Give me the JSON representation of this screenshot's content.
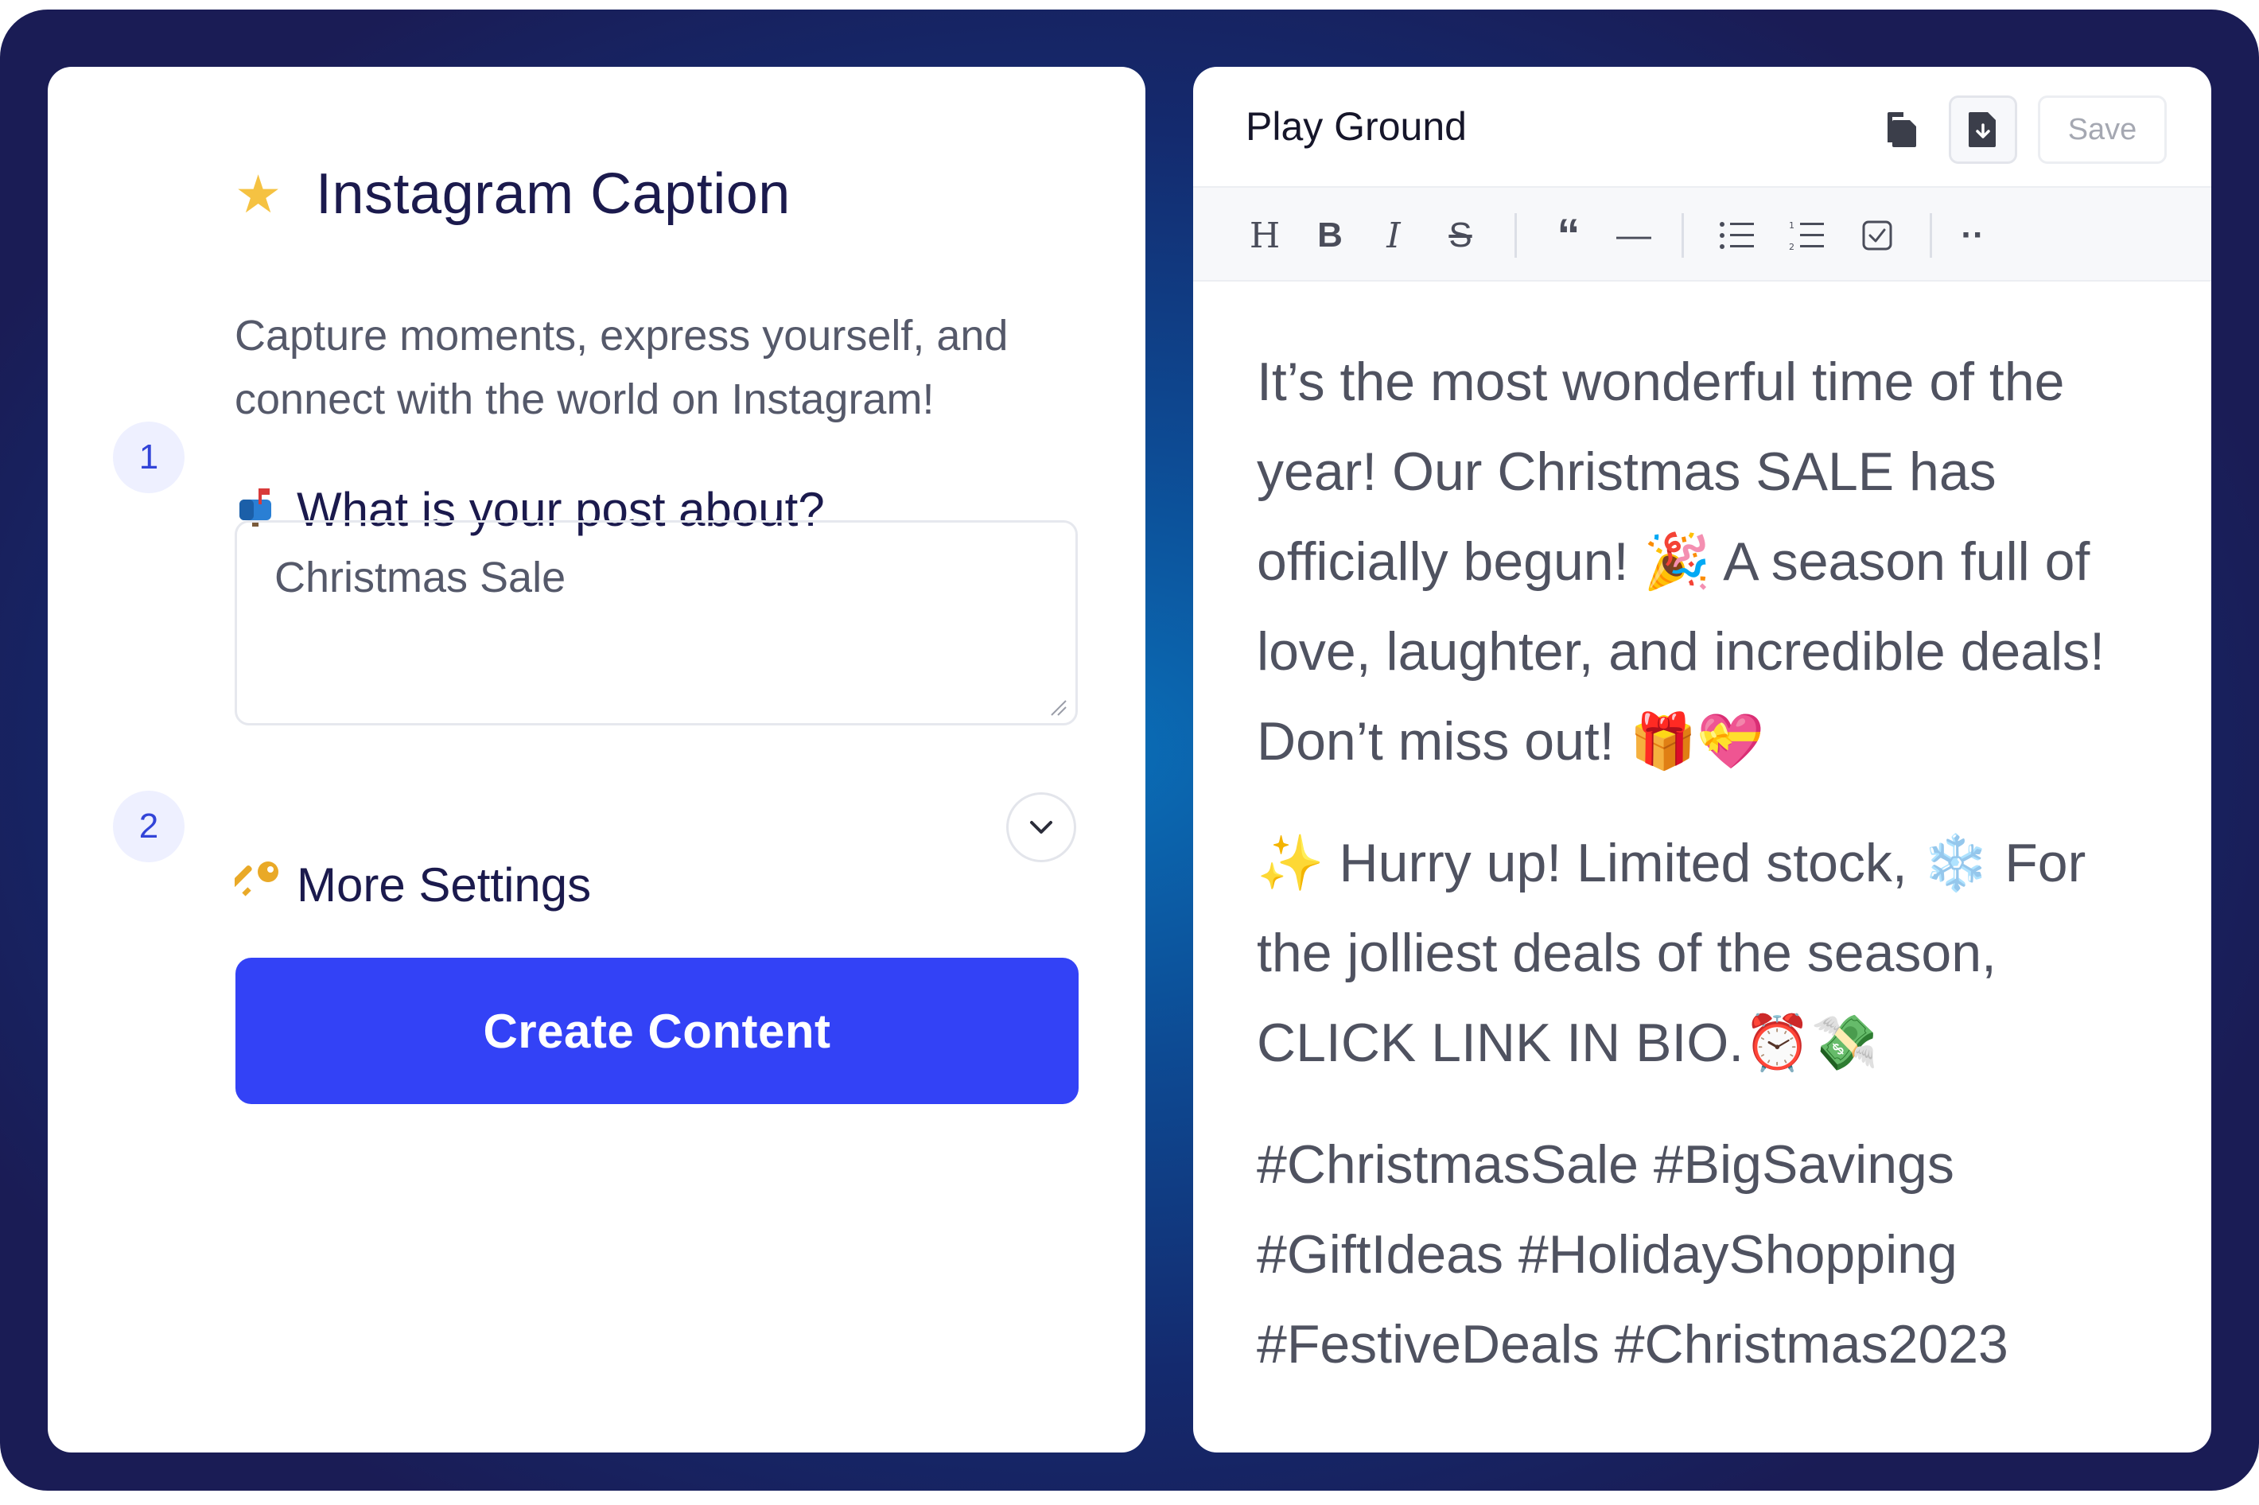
{
  "left_panel": {
    "title_icon": "star-icon",
    "title": "Instagram Caption",
    "subtitle": "Capture moments, express yourself, and connect with the world on Instagram!",
    "steps": [
      {
        "number": "1",
        "icon": "mailbox-icon",
        "label": "What is your post about?"
      },
      {
        "number": "2",
        "icon": "key-icon",
        "label": "More Settings"
      }
    ],
    "post_input": {
      "value": "Christmas Sale"
    },
    "create_button": "Create Content"
  },
  "right_panel": {
    "title": "Play Ground",
    "save_label": "Save",
    "toolbar_items": [
      "heading",
      "bold",
      "italic",
      "strikethrough",
      "quote",
      "horizontal-rule",
      "bullet-list",
      "numbered-list",
      "task-list",
      "more"
    ],
    "toolbar_glyphs": {
      "heading": "H",
      "bold": "B",
      "italic": "I",
      "strike": "S",
      "quote": "“",
      "rule": "—",
      "more": "··"
    },
    "paragraphs": [
      "It’s the most wonderful time of the year! Our Christmas SALE has officially begun! 🎉 A season full of love, laughter, and incredible deals! Don’t miss out! 🎁💝",
      "✨ Hurry up! Limited stock, ❄️ For the jolliest deals of the season, CLICK LINK IN BIO.⏰💸",
      "#ChristmasSale #BigSavings #GiftIdeas #HolidayShopping #FestiveDeals #Christmas2023"
    ]
  },
  "colors": {
    "accent": "#3342f6",
    "heading": "#1b1a4d",
    "body_text": "#4f5260",
    "badge_bg": "#eef0ff",
    "badge_text": "#3244d8"
  }
}
